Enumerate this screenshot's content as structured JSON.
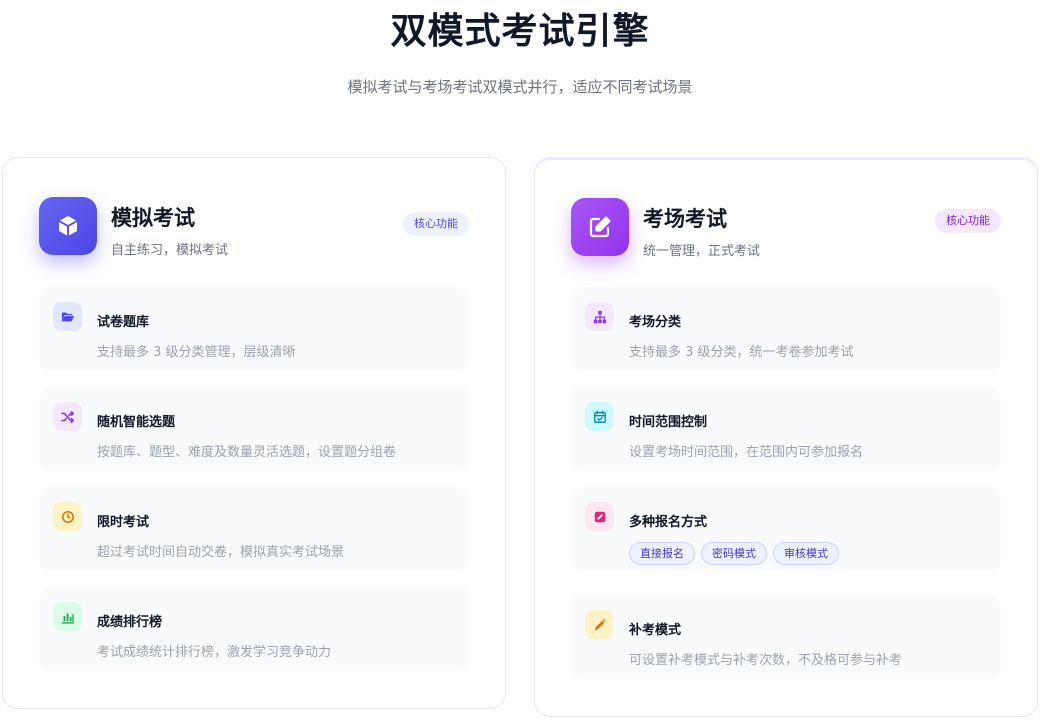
{
  "hero": {
    "title": "双模式考试引擎",
    "subtitle": "模拟考试与考场考试双模式并行，适应不同考试场景"
  },
  "mock": {
    "title": "模拟考试",
    "subtitle": "自主练习，模拟考试",
    "badge": "核心功能",
    "icon": "cube-icon",
    "features": [
      {
        "title": "试卷题库",
        "desc": "支持最多 3 级分类管理，层级清晰",
        "icon": "folder-open-icon",
        "color": "#4f46e5",
        "bg": "#e0e7ff"
      },
      {
        "title": "随机智能选题",
        "desc": "按题库、题型、难度及数量灵活选题，设置题分组卷",
        "icon": "shuffle-icon",
        "color": "#9333ea",
        "bg": "#f3e8ff"
      },
      {
        "title": "限时考试",
        "desc": "超过考试时间自动交卷，模拟真实考试场景",
        "icon": "clock-icon",
        "color": "#d97706",
        "bg": "#fef3c7"
      },
      {
        "title": "成绩排行榜",
        "desc": "考试成绩统计排行榜，激发学习竞争动力",
        "icon": "bar-chart-icon",
        "color": "#16a34a",
        "bg": "#dcfce7"
      }
    ]
  },
  "venue": {
    "title": "考场考试",
    "subtitle": "统一管理，正式考试",
    "badge": "核心功能",
    "icon": "edit-square-icon",
    "features": [
      {
        "title": "考场分类",
        "desc": "支持最多 3 级分类，统一考卷参加考试",
        "icon": "sitemap-icon",
        "color": "#9333ea",
        "bg": "#f3e8ff"
      },
      {
        "title": "时间范围控制",
        "desc": "设置考场时间范围，在范围内可参加报名",
        "icon": "calendar-check-icon",
        "color": "#0891b2",
        "bg": "#cffafe"
      },
      {
        "title": "多种报名方式",
        "tags": [
          "直接报名",
          "密码模式",
          "审核模式"
        ],
        "icon": "pen-square-icon",
        "color": "#db2777",
        "bg": "#fce7f3"
      },
      {
        "title": "补考模式",
        "desc": "可设置补考模式与补考次数，不及格可参与补考",
        "icon": "pencil-icon",
        "color": "#d97706",
        "bg": "#fef3c7"
      }
    ]
  }
}
